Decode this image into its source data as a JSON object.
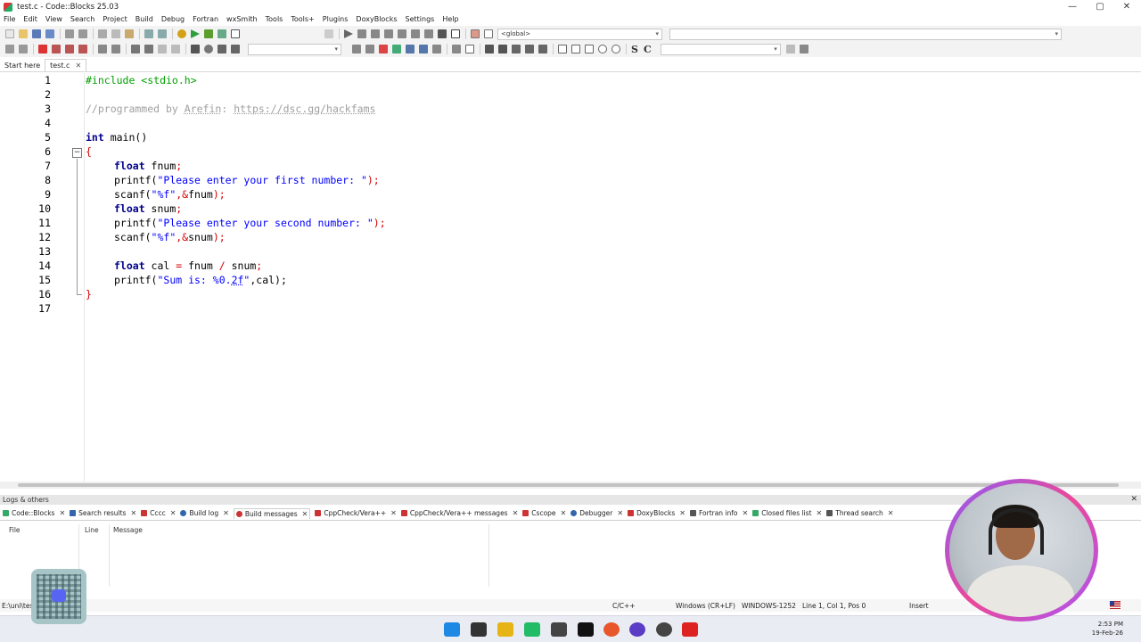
{
  "window": {
    "title": "test.c - Code::Blocks 25.03",
    "controls": [
      "—",
      "▢",
      "✕"
    ]
  },
  "menu": [
    "File",
    "Edit",
    "View",
    "Search",
    "Project",
    "Build",
    "Debug",
    "Fortran",
    "wxSmith",
    "Tools",
    "Tools+",
    "Plugins",
    "DoxyBlocks",
    "Settings",
    "Help"
  ],
  "toolbar": {
    "scope_combo": "<global>",
    "glyph_s": "S",
    "glyph_c": "C"
  },
  "tabs": [
    {
      "label": "Start here",
      "active": false
    },
    {
      "label": "test.c",
      "active": true,
      "close": "✕"
    }
  ],
  "editor": {
    "line_numbers": [
      "1",
      "2",
      "3",
      "4",
      "5",
      "6",
      "7",
      "8",
      "9",
      "10",
      "11",
      "12",
      "13",
      "14",
      "15",
      "16",
      "17"
    ],
    "code": {
      "l1": "#include <stdio.h>",
      "l3a": "//programmed by ",
      "l3b": "Arefin",
      "l3c": ": ",
      "l3d": "https://dsc.gg/hackfams",
      "l5a": "int",
      "l5b": " main()",
      "l6": "{",
      "l7a": "float",
      "l7b": " fnum",
      "l7c": ";",
      "l8a": "printf(",
      "l8b": "\"Please enter your first number: \"",
      "l8c": ");",
      "l9a": "scanf(",
      "l9b": "\"%f\"",
      "l9c": ",&",
      "l9d": "fnum",
      "l9e": ");",
      "l10a": "float",
      "l10b": " snum",
      "l10c": ";",
      "l11a": "printf(",
      "l11b": "\"Please enter your second number: \"",
      "l11c": ");",
      "l12a": "scanf(",
      "l12b": "\"%f\"",
      "l12c": ",&",
      "l12d": "snum",
      "l12e": ");",
      "l14a": "float",
      "l14b": " cal ",
      "l14c": "=",
      "l14d": " fnum ",
      "l14e": "/",
      "l14f": " snum",
      "l14g": ";",
      "l15a": "printf(",
      "l15b": "\"Sum is: %0.",
      "l15c": "2f",
      "l15d": "\"",
      "l15e": ",cal);",
      "l16": "}"
    },
    "fold_marker": "−"
  },
  "logs": {
    "title": "Logs & others",
    "close": "✕",
    "tabs": [
      {
        "label": "Code::Blocks",
        "color": "#3a6"
      },
      {
        "label": "Search results",
        "color": "#36a"
      },
      {
        "label": "Cccc",
        "color": "#c33"
      },
      {
        "label": "Build log",
        "color": "#36a"
      },
      {
        "label": "Build messages",
        "color": "#c33",
        "active": true
      },
      {
        "label": "CppCheck/Vera++",
        "color": "#c33"
      },
      {
        "label": "CppCheck/Vera++ messages",
        "color": "#c33"
      },
      {
        "label": "Cscope",
        "color": "#c33"
      },
      {
        "label": "Debugger",
        "color": "#36a"
      },
      {
        "label": "DoxyBlocks",
        "color": "#c33"
      },
      {
        "label": "Fortran info",
        "color": "#555"
      },
      {
        "label": "Closed files list",
        "color": "#3a6"
      },
      {
        "label": "Thread search",
        "color": "#555"
      }
    ],
    "tab_close": "✕",
    "columns": [
      "File",
      "Line",
      "Message"
    ]
  },
  "status": {
    "path": "E:\\uni\\tes",
    "language": "C/C++",
    "eol": "Windows (CR+LF)",
    "encoding": "WINDOWS-1252",
    "position": "Line 1, Col 1, Pos 0",
    "mode": "Insert"
  },
  "taskbar": {
    "time": "2:53 PM",
    "date": "19-Feb-26",
    "apps": [
      {
        "name": "windows",
        "color": "#1e88e5"
      },
      {
        "name": "terminal",
        "color": "#333"
      },
      {
        "name": "files",
        "color": "#e7b416"
      },
      {
        "name": "app1",
        "color": "#2b6"
      },
      {
        "name": "calendar",
        "color": "#444"
      },
      {
        "name": "notion",
        "color": "#111"
      },
      {
        "name": "firefox",
        "color": "#e8572b"
      },
      {
        "name": "app2",
        "color": "#5b3cc4"
      },
      {
        "name": "chrome",
        "color": "#444"
      },
      {
        "name": "codeblocks",
        "color": "#d22"
      }
    ]
  }
}
